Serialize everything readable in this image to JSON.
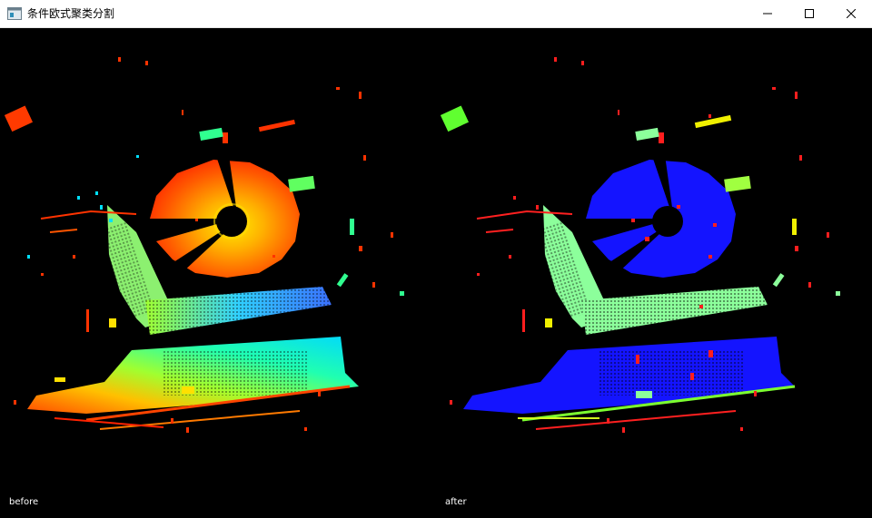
{
  "window": {
    "title": "条件欧式聚类分割",
    "icon": "app-window-icon",
    "controls": {
      "minimize_icon": "minimize-icon",
      "maximize_icon": "maximize-icon",
      "close_icon": "close-icon"
    }
  },
  "viewports": [
    {
      "label": "before",
      "coloring": "height-rainbow"
    },
    {
      "label": "after",
      "coloring": "cluster-labels"
    }
  ],
  "colors": {
    "background": "#000000",
    "after_main_cluster": "#1414ff",
    "after_noise": "#ff1e1e",
    "after_secondary": "#8cff9b",
    "after_highlight": "#f0f000",
    "before_high": "#ff2a00",
    "before_mid": "#a0ff20",
    "before_low": "#00e0ff"
  }
}
